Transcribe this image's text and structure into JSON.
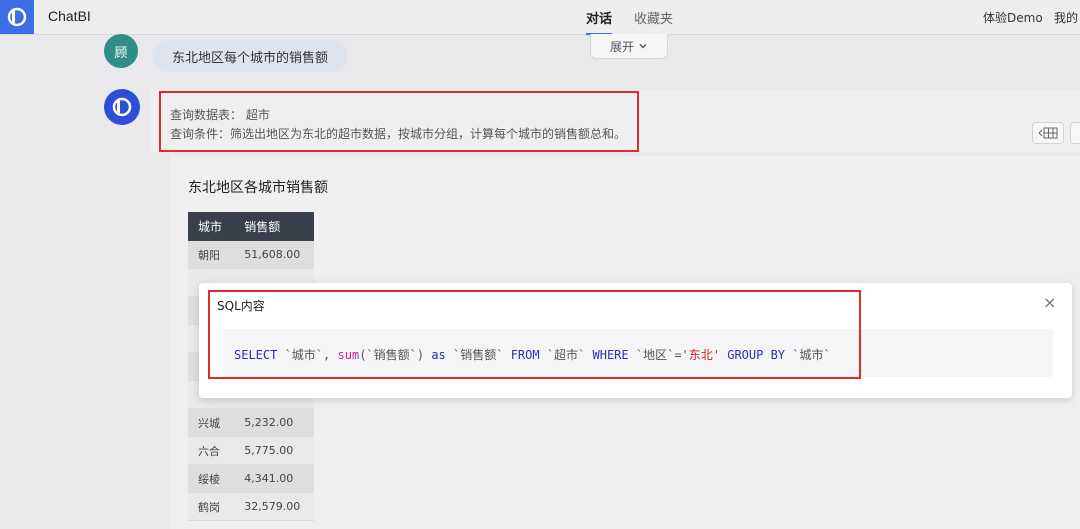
{
  "app": {
    "title": "ChatBI"
  },
  "nav": {
    "tabs": [
      {
        "label": "对话",
        "active": true
      },
      {
        "label": "收藏夹",
        "active": false
      }
    ]
  },
  "user": {
    "name": "体验Demo",
    "menu_partial": "我的"
  },
  "conversation": {
    "user_avatar_text": "顾",
    "user_message": "东北地区每个城市的销售额",
    "expand_label": "展开",
    "query_table_line": "查询数据表： 超市",
    "query_condition_line": "查询条件：筛选出地区为东北的超市数据，按城市分组，计算每个城市的销售额总和。"
  },
  "result": {
    "title": "东北地区各城市销售额",
    "columns": [
      "城市",
      "销售额"
    ],
    "rows": [
      [
        "朝阳",
        "51,608.00"
      ],
      [
        "",
        ""
      ],
      [
        "",
        ""
      ],
      [
        "",
        ""
      ],
      [
        "",
        ""
      ],
      [
        "",
        ""
      ],
      [
        "兴城",
        "5,232.00"
      ],
      [
        "六合",
        "5,775.00"
      ],
      [
        "绥棱",
        "4,341.00"
      ],
      [
        "鹤岗",
        "32,579.00"
      ]
    ]
  },
  "sql_modal": {
    "title": "SQL内容",
    "close_label": "×",
    "tokens": [
      {
        "t": "SELECT",
        "c": "kw"
      },
      {
        "t": " `城市`",
        "c": ""
      },
      {
        "t": ",",
        "c": ""
      },
      {
        "t": " sum",
        "c": "fn"
      },
      {
        "t": "(`销售额`)",
        "c": ""
      },
      {
        "t": " as",
        "c": "kw"
      },
      {
        "t": " `销售额`",
        "c": ""
      },
      {
        "t": " FROM",
        "c": "kw"
      },
      {
        "t": " `超市`",
        "c": ""
      },
      {
        "t": " WHERE",
        "c": "kw"
      },
      {
        "t": " `地区`=",
        "c": ""
      },
      {
        "t": "'东北'",
        "c": "str"
      },
      {
        "t": " GROUP BY",
        "c": "kw"
      },
      {
        "t": " `城市`",
        "c": ""
      }
    ]
  },
  "colors": {
    "accent": "#3d6ee8",
    "highlight_border": "#e12b2b",
    "table_header": "#3a3f4c"
  }
}
